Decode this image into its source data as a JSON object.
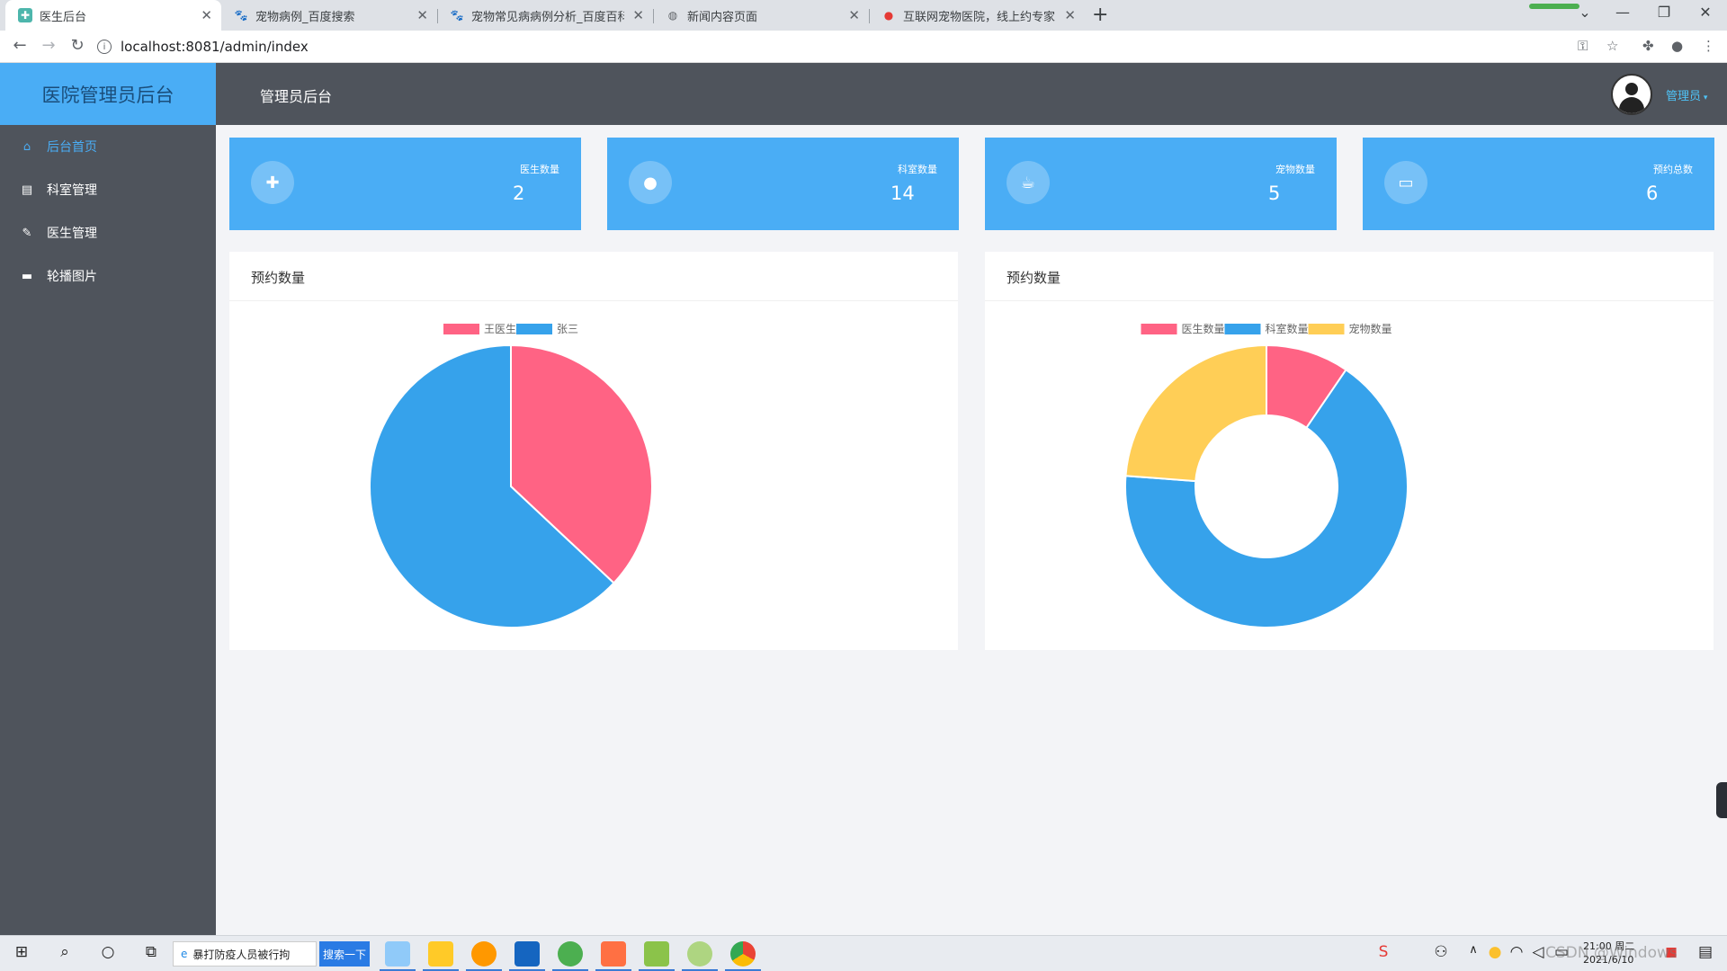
{
  "browser": {
    "tabs": [
      {
        "label": "医生后台",
        "active": true
      },
      {
        "label": "宠物病例_百度搜索",
        "active": false
      },
      {
        "label": "宠物常见病病例分析_百度百科",
        "active": false
      },
      {
        "label": "新闻内容页面",
        "active": false
      },
      {
        "label": "互联网宠物医院，线上约专家医生",
        "active": false
      }
    ],
    "url": "localhost:8081/admin/index"
  },
  "app": {
    "brand": "医院管理员后台",
    "header_title": "管理员后台",
    "admin_label": "管理员"
  },
  "sidebar": {
    "items": [
      {
        "label": "后台首页",
        "icon": "home-icon",
        "active": true
      },
      {
        "label": "科室管理",
        "icon": "comment-icon",
        "active": false
      },
      {
        "label": "医生管理",
        "icon": "pencil-icon",
        "active": false
      },
      {
        "label": "轮播图片",
        "icon": "message-icon",
        "active": false
      }
    ]
  },
  "stats": [
    {
      "label": "医生数量",
      "value": "2",
      "icon": "plus-chat-icon"
    },
    {
      "label": "科室数量",
      "value": "14",
      "icon": "user-icon"
    },
    {
      "label": "宠物数量",
      "value": "5",
      "icon": "cup-icon"
    },
    {
      "label": "预约总数",
      "value": "6",
      "icon": "monitor-icon"
    }
  ],
  "colors": {
    "accent": "#4aadf5",
    "sidebar": "#4f545c",
    "pink": "#ff6384",
    "blue": "#36a2eb",
    "yellow": "#ffce56"
  },
  "chart_data": [
    {
      "type": "pie",
      "title": "预约数量",
      "categories": [
        "王医生",
        "张三"
      ],
      "values": [
        37,
        63
      ],
      "colors": [
        "#ff6384",
        "#36a2eb"
      ],
      "legend": "top"
    },
    {
      "type": "pie",
      "title": "预约数量",
      "donut": true,
      "categories": [
        "医生数量",
        "科室数量",
        "宠物数量"
      ],
      "values": [
        2,
        14,
        5
      ],
      "colors": [
        "#ff6384",
        "#36a2eb",
        "#ffce56"
      ],
      "legend": "top"
    }
  ],
  "taskbar": {
    "search_text": "暴打防疫人员被行拘",
    "search_button": "搜索一下",
    "time": "21:00 周二",
    "date": "2021/6/10"
  },
  "watermark": "CSDN @Windows"
}
